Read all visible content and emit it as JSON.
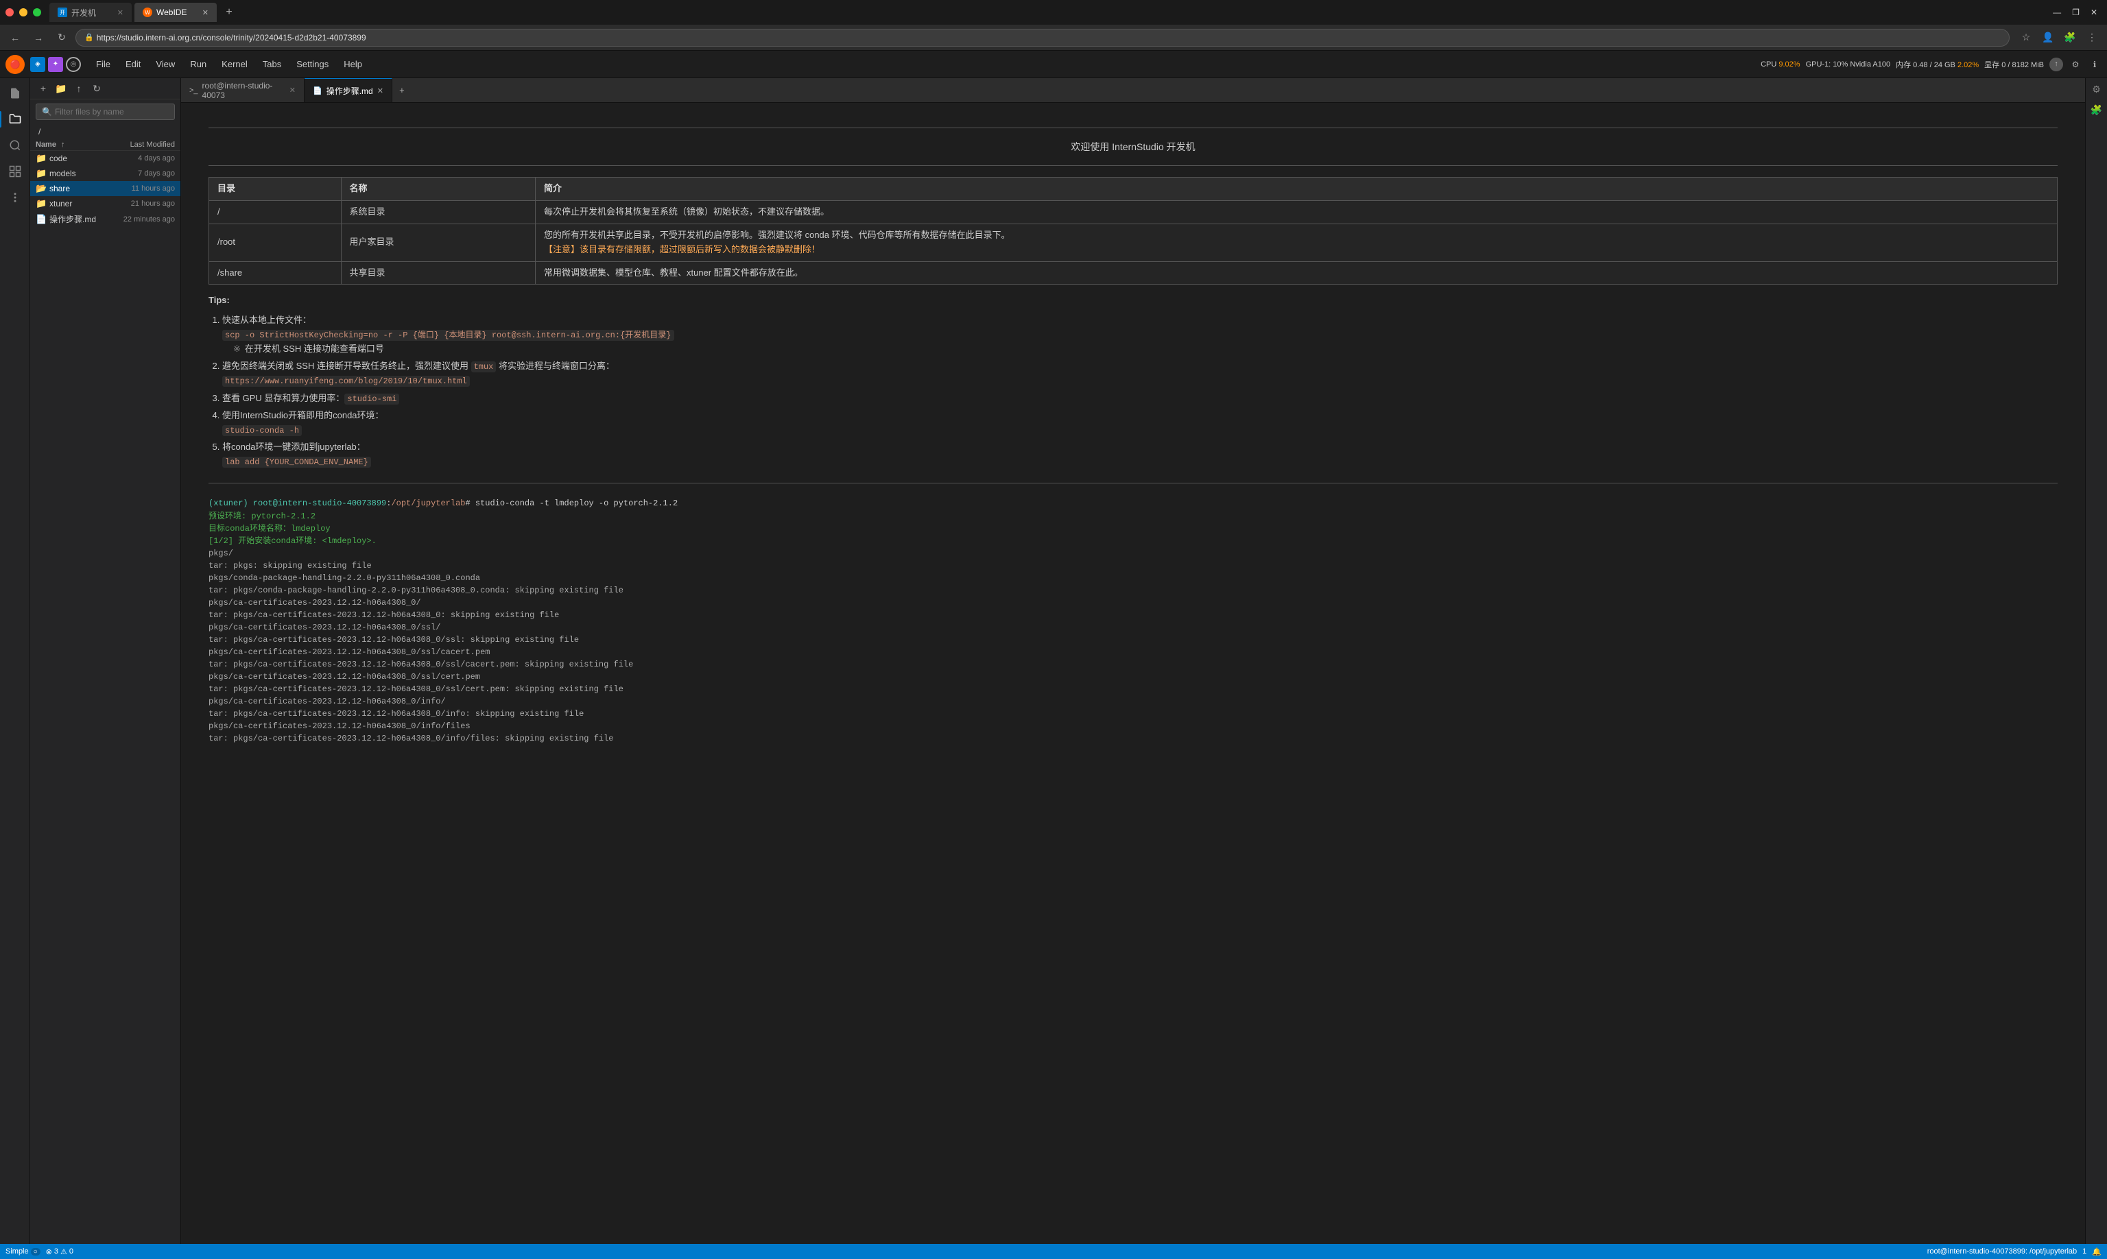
{
  "browser": {
    "tabs": [
      {
        "id": "dev",
        "label": "开发机",
        "url": "",
        "active": false,
        "favicon": "dev"
      },
      {
        "id": "webide",
        "label": "WebIDE",
        "url": "",
        "active": true,
        "favicon": "web"
      }
    ],
    "new_tab_label": "+",
    "url": "https://studio.intern-ai.org.cn/console/trinity/20240415-d2d2b21-40073899",
    "nav": {
      "back": "←",
      "forward": "→",
      "refresh": "↻",
      "home": "⌂"
    }
  },
  "app": {
    "top_icons": [
      "🔴",
      "≡",
      "◐"
    ],
    "menu": [
      "File",
      "Edit",
      "View",
      "Run",
      "Kernel",
      "Tabs",
      "Settings",
      "Help"
    ],
    "stats": {
      "cpu_label": "CPU",
      "cpu_val": "9.02%",
      "gpu_label": "GPU-1: 10% Nvidia A100",
      "gpu_val": "10%",
      "mem_label": "内存 0.48 / 24 GB",
      "mem_val": "2.02%",
      "vram_label": "显存 0 / 8182 MiB",
      "vram_val": "0%"
    }
  },
  "sidebar": {
    "search_placeholder": "Filter files by name",
    "path": "/",
    "columns": {
      "name": "Name",
      "modified": "Last Modified"
    },
    "files": [
      {
        "type": "folder",
        "name": "code",
        "modified": "4 days ago",
        "open": false
      },
      {
        "type": "folder",
        "name": "models",
        "modified": "7 days ago",
        "open": false
      },
      {
        "type": "folder",
        "name": "share",
        "modified": "11 hours ago",
        "open": false,
        "active": true
      },
      {
        "type": "folder",
        "name": "xtuner",
        "modified": "21 hours ago",
        "open": false
      },
      {
        "type": "file",
        "name": "操作步骤.md",
        "modified": "22 minutes ago",
        "open": false,
        "icon": "📄"
      }
    ]
  },
  "editor": {
    "tabs": [
      {
        "id": "terminal",
        "label": "root@intern-studio-40073",
        "active": false,
        "icon": ">_",
        "closable": true
      },
      {
        "id": "md",
        "label": "操作步骤.md",
        "active": true,
        "icon": "📄",
        "closable": true
      }
    ],
    "add_btn": "+",
    "md_content": {
      "divider1": true,
      "welcome": "欢迎使用 InternStudio 开发机",
      "divider2": true,
      "table_headers": [
        "目录",
        "名称",
        "简介"
      ],
      "table_rows": [
        [
          "/",
          "系统目录",
          "每次停止开发机会将其恢复至系统（镜像）初始状态，不建议存储数据。"
        ],
        [
          "/root",
          "用户家目录",
          "您的所有开发机共享此目录，不受开发机的启停影响。强烈建议将 conda 环境、代码仓库等所有数据存储在此目录下。\n【注意】该目录有存储限额，超过限额后新写入的数据会被静默删除！"
        ],
        [
          "/share",
          "共享目录",
          "常用微调数据集、模型仓库、教程、xtuner 配置文件都存放在此。"
        ]
      ],
      "tips_label": "Tips:",
      "tips": [
        {
          "num": 1,
          "text": "快速从本地上传文件：",
          "code": "scp -o StrictHostKeyChecking=no -r -P {端口} {本地目录} root@ssh.intern-ai.org.cn:{开发机目录}",
          "note": "※注：在开发机 SSH 连接功能查看端口号"
        },
        {
          "num": 2,
          "text": "避免因终端关闭或 SSH 连接断开导致任务终止，强烈建议使用 tmux 将实验进程与终端窗口分离：",
          "code": "https://www.ruanyifeng.com/blog/2019/10/tmux.html"
        },
        {
          "num": 3,
          "text": "查看 GPU 显存和算力使用率：",
          "code": "studio-smi"
        },
        {
          "num": 4,
          "text": "使用InternStudio开箱即用的conda环境：",
          "code": "studio-conda -h"
        },
        {
          "num": 5,
          "text": "将conda环境一键添加到jupyterlab：",
          "code": "lab add {YOUR_CONDA_ENV_NAME}"
        }
      ]
    },
    "terminal_content": {
      "prompt_user": "(xtuner)",
      "prompt_path": "root@intern-studio-40073899",
      "prompt_dir": "/opt/jupyterlab",
      "command": "# studio-conda -t lmdeploy -o pytorch-2.1.2",
      "output_lines": [
        "预设环境: pytorch-2.1.2",
        "目标conda环境名称：lmdeploy",
        "[1/2] 开始安装conda环境: <lmdeploy>.",
        "pkgs/",
        "tar: pkgs: skipping existing file",
        "pkgs/conda-package-handling-2.2.0-py311h06a4308_0.conda",
        "tar: pkgs/conda-package-handling-2.2.0-py311h06a4308_0.conda: skipping existing file",
        "pkgs/ca-certificates-2023.12.12-h06a4308_0/",
        "tar: pkgs/ca-certificates-2023.12.12-h06a4308_0: skipping existing file",
        "pkgs/ca-certificates-2023.12.12-h06a4308_0/ssl/",
        "tar: pkgs/ca-certificates-2023.12.12-h06a4308_0/ssl: skipping existing file",
        "pkgs/ca-certificates-2023.12.12-h06a4308_0/ssl/cacert.pem",
        "tar: pkgs/ca-certificates-2023.12.12-h06a4308_0/ssl/cacert.pem: skipping existing file",
        "pkgs/ca-certificates-2023.12.12-h06a4308_0/ssl/cert.pem",
        "tar: pkgs/ca-certificates-2023.12.12-h06a4308_0/ssl/cert.pem: skipping existing file",
        "pkgs/ca-certificates-2023.12.12-h06a4308_0/info/",
        "tar: pkgs/ca-certificates-2023.12.12-h06a4308_0/info: skipping existing file",
        "pkgs/ca-certificates-2023.12.12-h06a4308_0/info/files",
        "tar: pkgs/ca-certificates-2023.12.12-h06a4308_0/info/files: skipping existing file"
      ],
      "green_lines": [
        0,
        1,
        2
      ]
    }
  },
  "status_bar": {
    "left": [
      "Simple",
      "3",
      "0"
    ],
    "right": [
      "root@intern-studio-40073899: /opt/jupyterlab",
      "1",
      "🔔"
    ]
  }
}
